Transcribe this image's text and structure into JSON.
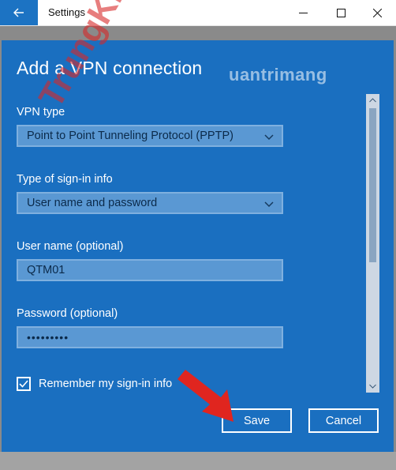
{
  "window": {
    "title": "Settings"
  },
  "dialog": {
    "title": "Add a VPN connection",
    "vpn_type": {
      "label": "VPN type",
      "value": "Point to Point Tunneling Protocol (PPTP)"
    },
    "signin_type": {
      "label": "Type of sign-in info",
      "value": "User name and password"
    },
    "username": {
      "label": "User name (optional)",
      "value": "QTM01"
    },
    "password": {
      "label": "Password (optional)",
      "value": "•••••••••"
    },
    "remember": {
      "label": "Remember my sign-in info",
      "checked": true
    },
    "buttons": {
      "save": "Save",
      "cancel": "Cancel"
    }
  },
  "watermark": {
    "brand": "uantrimang",
    "diagonal": "TrungKha.top"
  },
  "colors": {
    "dialog_bg": "#1a6fc0",
    "field_bg": "#5a98d3",
    "arrow": "#e0251f"
  },
  "icons": [
    "back-arrow-icon",
    "minimize-icon",
    "maximize-icon",
    "close-icon",
    "chevron-down-icon",
    "checkmark-icon",
    "scroll-up-icon",
    "scroll-down-icon"
  ]
}
